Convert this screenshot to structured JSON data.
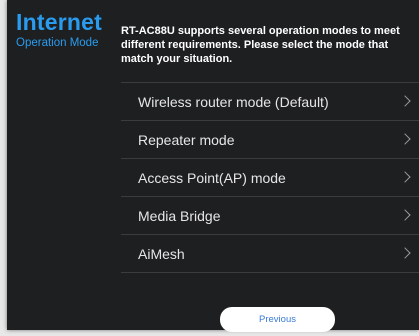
{
  "header": {
    "title": "Internet",
    "subtitle": "Operation Mode"
  },
  "description": "RT-AC88U supports several operation modes to meet different requirements. Please select the mode that match your situation.",
  "modes": [
    {
      "label": "Wireless router mode (Default)"
    },
    {
      "label": "Repeater mode"
    },
    {
      "label": "Access Point(AP) mode"
    },
    {
      "label": "Media Bridge"
    },
    {
      "label": "AiMesh"
    }
  ],
  "footer": {
    "previous_label": "Previous"
  },
  "colors": {
    "accent": "#2a9cf0",
    "panel_background": "#1d1f21",
    "text": "#ffffff",
    "divider": "#3a3c3e"
  },
  "icons": {
    "option_arrow": "chevron-right-icon"
  }
}
